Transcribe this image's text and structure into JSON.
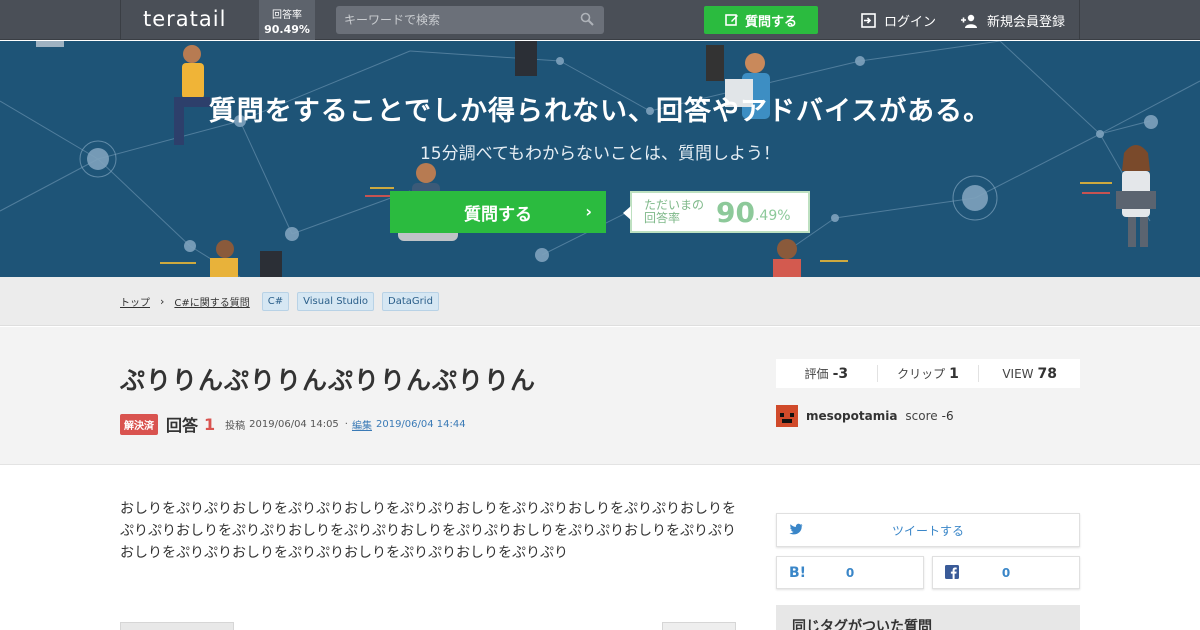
{
  "header": {
    "logo": "teratail",
    "answer_rate_label": "回答率",
    "answer_rate_value": "90.49%",
    "search_placeholder": "キーワードで検索",
    "ask_button": "質問する",
    "login": "ログイン",
    "signup": "新規会員登録"
  },
  "hero": {
    "title": "質問をすることでしか得られない、回答やアドバイスがある。",
    "subtitle": "15分調べてもわからないことは、質問しよう！",
    "ask_button": "質問する",
    "rate_label": "ただいまの回答率",
    "rate_big": "90",
    "rate_small": ".49%"
  },
  "breadcrumb": {
    "items": [
      "トップ",
      "C#に関する質問"
    ],
    "tags": [
      "C#",
      "Visual Studio",
      "DataGrid"
    ]
  },
  "question": {
    "title": "ぷりりんぷりりんぷりりんぷりりん",
    "status": "解決済",
    "answers_label": "回答",
    "answers_count": "1",
    "posted_label": "投稿",
    "posted_time": "2019/06/04 14:05",
    "edited_label": "編集",
    "edited_time": "2019/06/04 14:44",
    "body": "おしりをぷりぷりおしりをぷりぷりおしりをぷりぷりおしりをぷりぷりおしりをぷりぷりおしりをぷりぷりおしりをぷりぷりおしりをぷりぷりおしりをぷりぷりおしりをぷりぷりおしりをぷりぷりおしりをぷりぷりおしりをぷりぷりおしりをぷりぷりおしりをぷりぷり"
  },
  "stats": {
    "rating_label": "評価",
    "rating_value": "-3",
    "clip_label": "クリップ",
    "clip_value": "1",
    "view_label": "VIEW",
    "view_value": "78"
  },
  "user": {
    "name": "mesopotamia",
    "score_label": "score",
    "score_value": "-6"
  },
  "sidebar": {
    "tweet": "ツイートする",
    "hatena_count": "0",
    "facebook_count": "0",
    "related_title": "同じタグがついた質問"
  },
  "colors": {
    "header_bg": "#4a4f57",
    "hero_bg": "#1e5477",
    "green": "#2bbb3f",
    "solved_red": "#d9534f",
    "link_blue": "#3a7ab6"
  },
  "icons": {
    "search": "search-icon",
    "edit": "pencil-icon",
    "login": "login-icon",
    "signup": "add-user-icon",
    "twitter": "twitter-icon",
    "hatena": "hatena-bookmark-icon",
    "facebook": "facebook-icon"
  }
}
